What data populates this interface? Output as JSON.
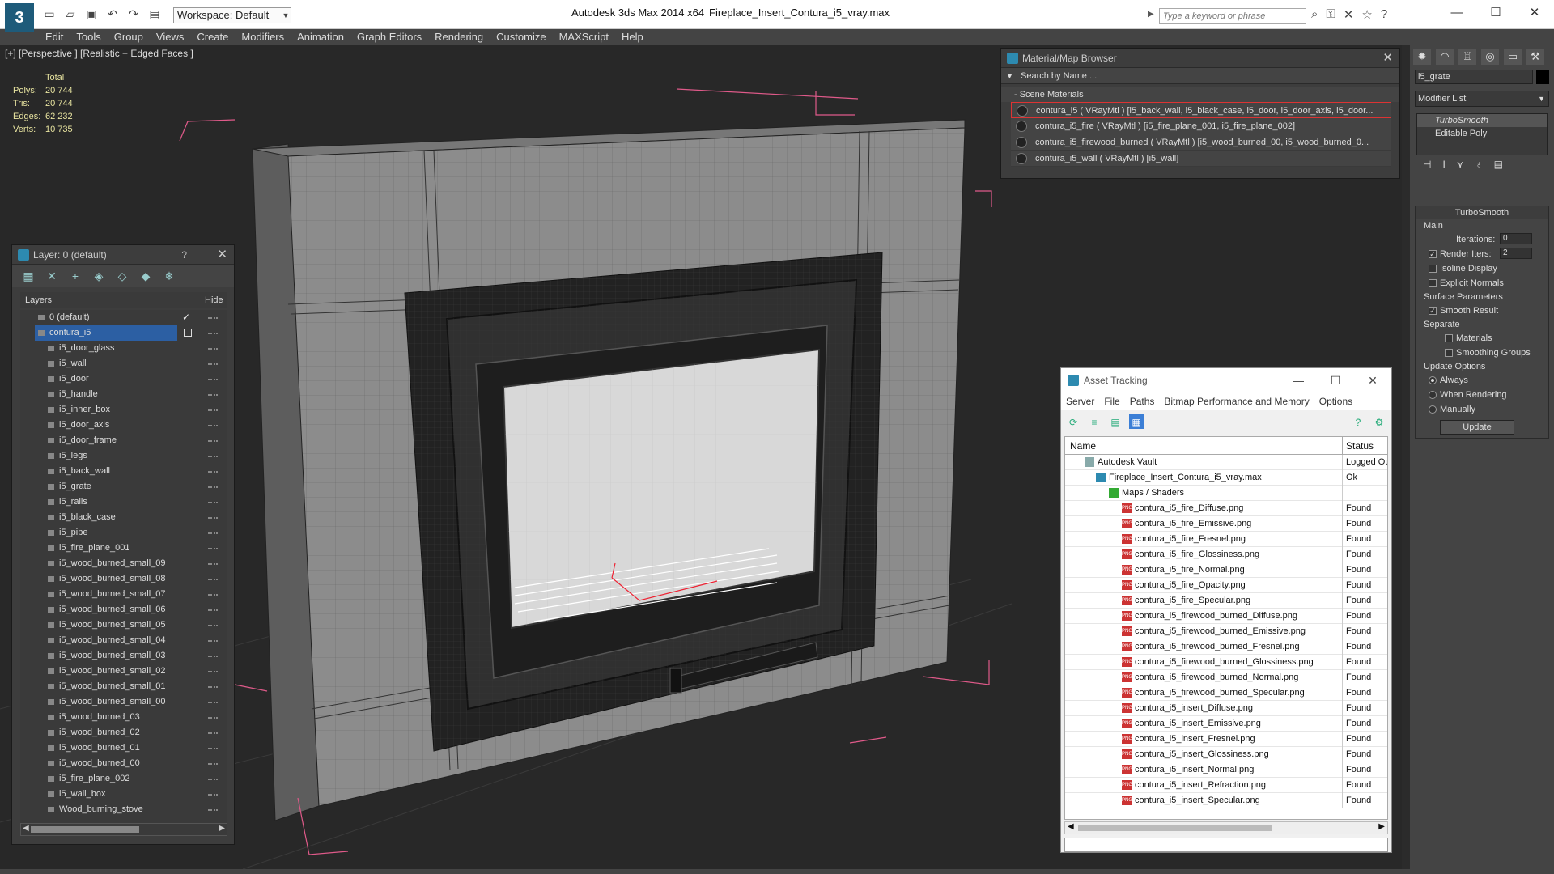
{
  "titlebar": {
    "workspace": "Workspace: Default",
    "app_title": "Autodesk 3ds Max  2014 x64",
    "file_title": "Fireplace_Insert_Contura_i5_vray.max",
    "search_placeholder": "Type a keyword or phrase"
  },
  "menu": [
    "Edit",
    "Tools",
    "Group",
    "Views",
    "Create",
    "Modifiers",
    "Animation",
    "Graph Editors",
    "Rendering",
    "Customize",
    "MAXScript",
    "Help"
  ],
  "viewport": {
    "label": "[+] [Perspective ] [Realistic + Edged Faces ]",
    "stats": {
      "total_label": "Total",
      "rows": [
        {
          "k": "Polys:",
          "v": "20 744"
        },
        {
          "k": "Tris:",
          "v": "20 744"
        },
        {
          "k": "Edges:",
          "v": "62 232"
        },
        {
          "k": "Verts:",
          "v": "10 735"
        }
      ]
    }
  },
  "layer_panel": {
    "title": "Layer: 0 (default)",
    "help": "?",
    "col_layers": "Layers",
    "col_hide": "Hide",
    "default_layer": "0 (default)",
    "selected_layer": "contura_i5",
    "items": [
      "i5_door_glass",
      "i5_wall",
      "i5_door",
      "i5_handle",
      "i5_inner_box",
      "i5_door_axis",
      "i5_door_frame",
      "i5_legs",
      "i5_back_wall",
      "i5_grate",
      "i5_rails",
      "i5_black_case",
      "i5_pipe",
      "i5_fire_plane_001",
      "i5_wood_burned_small_09",
      "i5_wood_burned_small_08",
      "i5_wood_burned_small_07",
      "i5_wood_burned_small_06",
      "i5_wood_burned_small_05",
      "i5_wood_burned_small_04",
      "i5_wood_burned_small_03",
      "i5_wood_burned_small_02",
      "i5_wood_burned_small_01",
      "i5_wood_burned_small_00",
      "i5_wood_burned_03",
      "i5_wood_burned_02",
      "i5_wood_burned_01",
      "i5_wood_burned_00",
      "i5_fire_plane_002",
      "i5_wall_box",
      "Wood_burning_stove"
    ]
  },
  "material_browser": {
    "title": "Material/Map Browser",
    "search": "Search by Name ...",
    "section": "- Scene Materials",
    "rows": [
      "contura_i5  ( VRayMtl ) [i5_back_wall, i5_black_case, i5_door, i5_door_axis, i5_door...",
      "contura_i5_fire  ( VRayMtl ) [i5_fire_plane_001, i5_fire_plane_002]",
      "contura_i5_firewood_burned  ( VRayMtl ) [i5_wood_burned_00, i5_wood_burned_0...",
      "contura_i5_wall  ( VRayMtl ) [i5_wall]"
    ]
  },
  "command_panel": {
    "object_name": "i5_grate",
    "modifier_list": "Modifier List",
    "stack": [
      "TurboSmooth",
      "Editable Poly"
    ],
    "turbosmooth_title": "TurboSmooth",
    "main": "Main",
    "iterations_label": "Iterations:",
    "iterations_value": "0",
    "render_iters_label": "Render Iters:",
    "render_iters_value": "2",
    "isoline": "Isoline Display",
    "explicit": "Explicit Normals",
    "surface_params": "Surface Parameters",
    "smooth_result": "Smooth Result",
    "separate": "Separate",
    "materials": "Materials",
    "smoothing_groups": "Smoothing Groups",
    "update_options": "Update Options",
    "always": "Always",
    "when_rendering": "When Rendering",
    "manually": "Manually",
    "update": "Update"
  },
  "asset_tracking": {
    "title": "Asset Tracking",
    "menu": [
      "Server",
      "File",
      "Paths",
      "Bitmap Performance and Memory",
      "Options"
    ],
    "col_name": "Name",
    "col_status": "Status",
    "vault": {
      "name": "Autodesk Vault",
      "status": "Logged Ou"
    },
    "maxfile": {
      "name": "Fireplace_Insert_Contura_i5_vray.max",
      "status": "Ok"
    },
    "maps": {
      "name": "Maps / Shaders",
      "status": ""
    },
    "files": [
      {
        "name": "contura_i5_fire_Diffuse.png",
        "status": "Found"
      },
      {
        "name": "contura_i5_fire_Emissive.png",
        "status": "Found"
      },
      {
        "name": "contura_i5_fire_Fresnel.png",
        "status": "Found"
      },
      {
        "name": "contura_i5_fire_Glossiness.png",
        "status": "Found"
      },
      {
        "name": "contura_i5_fire_Normal.png",
        "status": "Found"
      },
      {
        "name": "contura_i5_fire_Opacity.png",
        "status": "Found"
      },
      {
        "name": "contura_i5_fire_Specular.png",
        "status": "Found"
      },
      {
        "name": "contura_i5_firewood_burned_Diffuse.png",
        "status": "Found"
      },
      {
        "name": "contura_i5_firewood_burned_Emissive.png",
        "status": "Found"
      },
      {
        "name": "contura_i5_firewood_burned_Fresnel.png",
        "status": "Found"
      },
      {
        "name": "contura_i5_firewood_burned_Glossiness.png",
        "status": "Found"
      },
      {
        "name": "contura_i5_firewood_burned_Normal.png",
        "status": "Found"
      },
      {
        "name": "contura_i5_firewood_burned_Specular.png",
        "status": "Found"
      },
      {
        "name": "contura_i5_insert_Diffuse.png",
        "status": "Found"
      },
      {
        "name": "contura_i5_insert_Emissive.png",
        "status": "Found"
      },
      {
        "name": "contura_i5_insert_Fresnel.png",
        "status": "Found"
      },
      {
        "name": "contura_i5_insert_Glossiness.png",
        "status": "Found"
      },
      {
        "name": "contura_i5_insert_Normal.png",
        "status": "Found"
      },
      {
        "name": "contura_i5_insert_Refraction.png",
        "status": "Found"
      },
      {
        "name": "contura_i5_insert_Specular.png",
        "status": "Found"
      }
    ]
  }
}
